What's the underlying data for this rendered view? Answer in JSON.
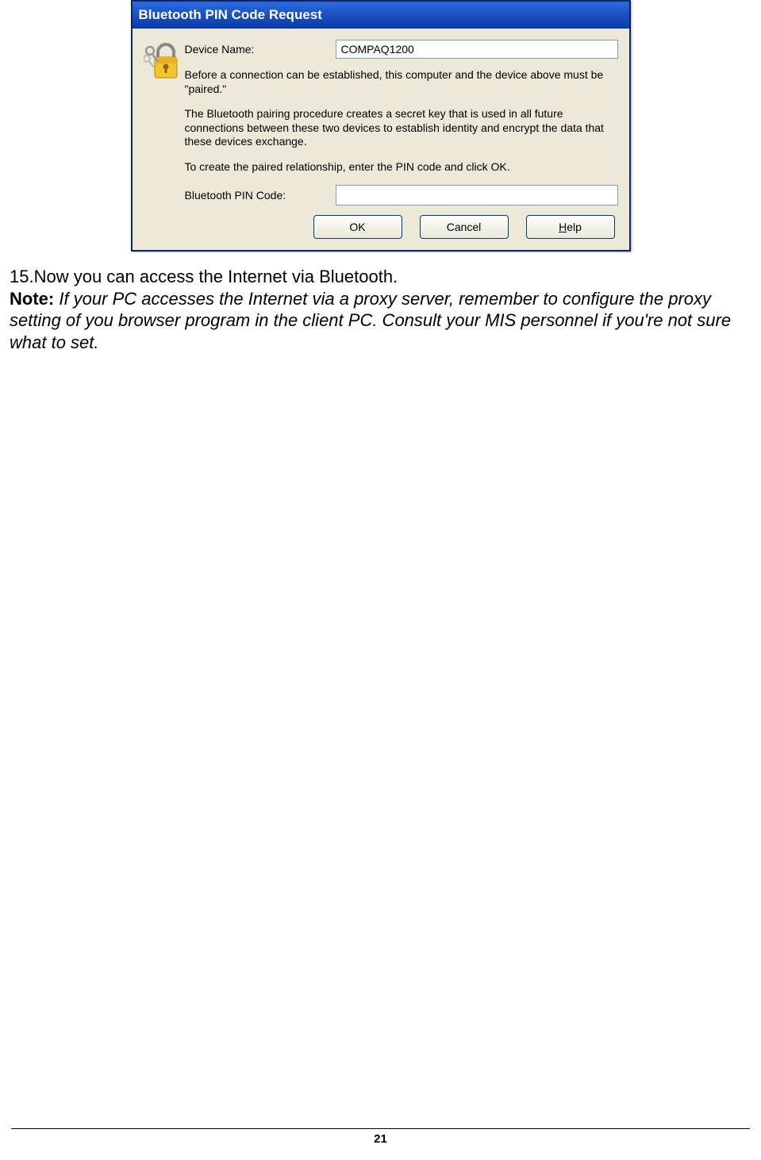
{
  "dialog": {
    "title": "Bluetooth PIN Code Request",
    "deviceNameLabel": "Device Name:",
    "deviceNameValue": "COMPAQ1200",
    "para1": "Before a connection can be established, this computer and the device above must be \"paired.\"",
    "para2": "The Bluetooth pairing procedure creates a secret key that is used in all future connections between these two devices to establish identity and encrypt the data that these devices exchange.",
    "para3": "To create the paired relationship, enter the PIN code and click OK.",
    "pinLabel": "Bluetooth PIN Code:",
    "pinValue": "",
    "buttons": {
      "ok": "OK",
      "cancel": "Cancel",
      "helpPrefix": "H",
      "helpRest": "elp"
    }
  },
  "bodyText": {
    "step15": "15.Now you can access the Internet via Bluetooth.",
    "noteLabel": "Note:",
    "noteText": " If your PC accesses the Internet via a proxy server, remember to configure the proxy setting of you browser program in the client PC. Consult your MIS personnel if you're not sure what to set."
  },
  "pageNumber": "21"
}
